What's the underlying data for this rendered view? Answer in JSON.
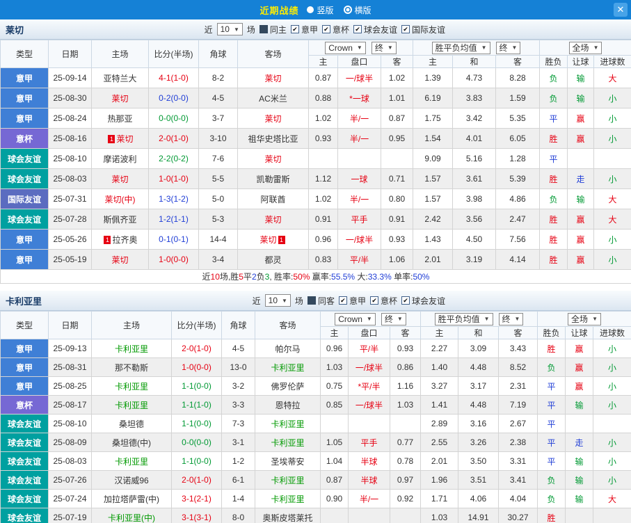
{
  "topbar": {
    "title": "近期战绩",
    "radio_vertical": "竖版",
    "radio_horizontal": "横版",
    "close": "✕"
  },
  "filter_words": {
    "near": "近",
    "games": "场"
  },
  "columns": {
    "cols": [
      "类型",
      "日期",
      "主场",
      "比分(半场)",
      "角球",
      "客场"
    ],
    "sub": [
      "主",
      "盘口",
      "客",
      "主",
      "和",
      "客",
      "胜负",
      "让球",
      "进球数"
    ],
    "bookmaker": "Crown",
    "final1": "终",
    "avg": "胜平负均值",
    "final2": "终",
    "scope": "全场"
  },
  "tables": [
    {
      "team": "莱切",
      "focal": "red",
      "filter": {
        "count": "10",
        "checks": [
          {
            "label": "同主",
            "checked": false,
            "solid": true
          },
          {
            "label": "意甲",
            "checked": true
          },
          {
            "label": "意杯",
            "checked": true
          },
          {
            "label": "球会友谊",
            "checked": true
          },
          {
            "label": "国际友谊",
            "checked": true
          }
        ]
      },
      "rows": [
        {
          "type": "意甲",
          "tc": "serie",
          "date": "25-09-14",
          "home": "亚特兰大",
          "hf": false,
          "hb": "",
          "score": "4-1(1-0)",
          "sc": "red",
          "corner": "8-2",
          "away": "莱切",
          "af": true,
          "ab": "",
          "o1": "0.87",
          "hcp": "一/球半",
          "o2": "1.02",
          "a1": "1.39",
          "a2": "4.73",
          "a3": "8.28",
          "r": "负",
          "rc": "green",
          "hr": "输",
          "hrc": "green",
          "g": "大",
          "gc": "red"
        },
        {
          "type": "意甲",
          "tc": "serie",
          "date": "25-08-30",
          "home": "莱切",
          "hf": true,
          "hb": "",
          "score": "0-2(0-0)",
          "sc": "blue",
          "corner": "4-5",
          "away": "AC米兰",
          "af": false,
          "ab": "",
          "o1": "0.88",
          "hcp": "*一球",
          "o2": "1.01",
          "a1": "6.19",
          "a2": "3.83",
          "a3": "1.59",
          "r": "负",
          "rc": "green",
          "hr": "输",
          "hrc": "green",
          "g": "小",
          "gc": "green"
        },
        {
          "type": "意甲",
          "tc": "serie",
          "date": "25-08-24",
          "home": "热那亚",
          "hf": false,
          "hb": "",
          "score": "0-0(0-0)",
          "sc": "green",
          "corner": "3-7",
          "away": "莱切",
          "af": true,
          "ab": "",
          "o1": "1.02",
          "hcp": "半/一",
          "o2": "0.87",
          "a1": "1.75",
          "a2": "3.42",
          "a3": "5.35",
          "r": "平",
          "rc": "blue",
          "hr": "赢",
          "hrc": "red",
          "g": "小",
          "gc": "green"
        },
        {
          "type": "意杯",
          "tc": "cup",
          "date": "25-08-16",
          "home": "莱切",
          "hf": true,
          "hb": "1",
          "score": "2-0(1-0)",
          "sc": "red",
          "corner": "3-10",
          "away": "祖华史塔比亚",
          "af": false,
          "ab": "",
          "o1": "0.93",
          "hcp": "半/一",
          "o2": "0.95",
          "a1": "1.54",
          "a2": "4.01",
          "a3": "6.05",
          "r": "胜",
          "rc": "red",
          "hr": "赢",
          "hrc": "red",
          "g": "小",
          "gc": "green"
        },
        {
          "type": "球会友谊",
          "tc": "club",
          "date": "25-08-10",
          "home": "摩诺波利",
          "hf": false,
          "hb": "",
          "score": "2-2(0-2)",
          "sc": "green",
          "corner": "7-6",
          "away": "莱切",
          "af": true,
          "ab": "",
          "o1": "",
          "hcp": "",
          "o2": "",
          "a1": "9.09",
          "a2": "5.16",
          "a3": "1.28",
          "r": "平",
          "rc": "blue",
          "hr": "",
          "hrc": "dark",
          "g": "",
          "gc": "dark"
        },
        {
          "type": "球会友谊",
          "tc": "club",
          "date": "25-08-03",
          "home": "莱切",
          "hf": true,
          "hb": "",
          "score": "1-0(1-0)",
          "sc": "red",
          "corner": "5-5",
          "away": "凯勒雷斯",
          "af": false,
          "ab": "",
          "o1": "1.12",
          "hcp": "一球",
          "o2": "0.71",
          "a1": "1.57",
          "a2": "3.61",
          "a3": "5.39",
          "r": "胜",
          "rc": "red",
          "hr": "走",
          "hrc": "blue",
          "g": "小",
          "gc": "green"
        },
        {
          "type": "国际友谊",
          "tc": "intl",
          "date": "25-07-31",
          "home": "莱切(中)",
          "hf": true,
          "hb": "",
          "score": "1-3(1-2)",
          "sc": "blue",
          "corner": "5-0",
          "away": "阿联酋",
          "af": false,
          "ab": "",
          "o1": "1.02",
          "hcp": "半/一",
          "o2": "0.80",
          "a1": "1.57",
          "a2": "3.98",
          "a3": "4.86",
          "r": "负",
          "rc": "green",
          "hr": "输",
          "hrc": "green",
          "g": "大",
          "gc": "red"
        },
        {
          "type": "球会友谊",
          "tc": "club",
          "date": "25-07-28",
          "home": "斯佩齐亚",
          "hf": false,
          "hb": "",
          "score": "1-2(1-1)",
          "sc": "blue",
          "corner": "5-3",
          "away": "莱切",
          "af": true,
          "ab": "",
          "o1": "0.91",
          "hcp": "平手",
          "o2": "0.91",
          "a1": "2.42",
          "a2": "3.56",
          "a3": "2.47",
          "r": "胜",
          "rc": "red",
          "hr": "赢",
          "hrc": "red",
          "g": "大",
          "gc": "red"
        },
        {
          "type": "意甲",
          "tc": "serie",
          "date": "25-05-26",
          "home": "拉齐奥",
          "hf": false,
          "hb": "1",
          "score": "0-1(0-1)",
          "sc": "blue",
          "corner": "14-4",
          "away": "莱切",
          "af": true,
          "ab": "1",
          "o1": "0.96",
          "hcp": "一/球半",
          "o2": "0.93",
          "a1": "1.43",
          "a2": "4.50",
          "a3": "7.56",
          "r": "胜",
          "rc": "red",
          "hr": "赢",
          "hrc": "red",
          "g": "小",
          "gc": "green"
        },
        {
          "type": "意甲",
          "tc": "serie",
          "date": "25-05-19",
          "home": "莱切",
          "hf": true,
          "hb": "",
          "score": "1-0(0-0)",
          "sc": "red",
          "corner": "3-4",
          "away": "都灵",
          "af": false,
          "ab": "",
          "o1": "0.83",
          "hcp": "平/半",
          "o2": "1.06",
          "a1": "2.01",
          "a2": "3.19",
          "a3": "4.14",
          "r": "胜",
          "rc": "red",
          "hr": "赢",
          "hrc": "red",
          "g": "小",
          "gc": "green"
        }
      ],
      "summary": [
        {
          "t": "近",
          "c": "dark"
        },
        {
          "t": "10",
          "c": "red"
        },
        {
          "t": "场,胜",
          "c": "dark"
        },
        {
          "t": "5",
          "c": "red"
        },
        {
          "t": "平",
          "c": "dark"
        },
        {
          "t": "2",
          "c": "blue"
        },
        {
          "t": "负",
          "c": "dark"
        },
        {
          "t": "3",
          "c": "green"
        },
        {
          "t": ", 胜率:",
          "c": "dark"
        },
        {
          "t": "50%",
          "c": "red"
        },
        {
          "t": " 赢率:",
          "c": "dark"
        },
        {
          "t": "55.5%",
          "c": "blue"
        },
        {
          "t": " 大:",
          "c": "dark"
        },
        {
          "t": "33.3%",
          "c": "blue"
        },
        {
          "t": " 单率:",
          "c": "dark"
        },
        {
          "t": "50%",
          "c": "blue"
        }
      ]
    },
    {
      "team": "卡利亚里",
      "focal": "green",
      "filter": {
        "count": "10",
        "checks": [
          {
            "label": "同客",
            "checked": false,
            "solid": true
          },
          {
            "label": "意甲",
            "checked": true
          },
          {
            "label": "意杯",
            "checked": true
          },
          {
            "label": "球会友谊",
            "checked": true
          }
        ]
      },
      "rows": [
        {
          "type": "意甲",
          "tc": "serie",
          "date": "25-09-13",
          "home": "卡利亚里",
          "hf": true,
          "hb": "",
          "score": "2-0(1-0)",
          "sc": "red",
          "corner": "4-5",
          "away": "帕尔马",
          "af": false,
          "ab": "",
          "o1": "0.96",
          "hcp": "平/半",
          "o2": "0.93",
          "a1": "2.27",
          "a2": "3.09",
          "a3": "3.43",
          "r": "胜",
          "rc": "red",
          "hr": "赢",
          "hrc": "red",
          "g": "小",
          "gc": "green"
        },
        {
          "type": "意甲",
          "tc": "serie",
          "date": "25-08-31",
          "home": "那不勒斯",
          "hf": false,
          "hb": "",
          "score": "1-0(0-0)",
          "sc": "red",
          "corner": "13-0",
          "away": "卡利亚里",
          "af": true,
          "ab": "",
          "o1": "1.03",
          "hcp": "一/球半",
          "o2": "0.86",
          "a1": "1.40",
          "a2": "4.48",
          "a3": "8.52",
          "r": "负",
          "rc": "green",
          "hr": "赢",
          "hrc": "red",
          "g": "小",
          "gc": "green"
        },
        {
          "type": "意甲",
          "tc": "serie",
          "date": "25-08-25",
          "home": "卡利亚里",
          "hf": true,
          "hb": "",
          "score": "1-1(0-0)",
          "sc": "green",
          "corner": "3-2",
          "away": "佛罗伦萨",
          "af": false,
          "ab": "",
          "o1": "0.75",
          "hcp": "*平/半",
          "o2": "1.16",
          "a1": "3.27",
          "a2": "3.17",
          "a3": "2.31",
          "r": "平",
          "rc": "blue",
          "hr": "赢",
          "hrc": "red",
          "g": "小",
          "gc": "green"
        },
        {
          "type": "意杯",
          "tc": "cup",
          "date": "25-08-17",
          "home": "卡利亚里",
          "hf": true,
          "hb": "",
          "score": "1-1(1-0)",
          "sc": "green",
          "corner": "3-3",
          "away": "恩特拉",
          "af": false,
          "ab": "",
          "o1": "0.85",
          "hcp": "一/球半",
          "o2": "1.03",
          "a1": "1.41",
          "a2": "4.48",
          "a3": "7.19",
          "r": "平",
          "rc": "blue",
          "hr": "输",
          "hrc": "green",
          "g": "小",
          "gc": "green"
        },
        {
          "type": "球会友谊",
          "tc": "club",
          "date": "25-08-10",
          "home": "桑坦德",
          "hf": false,
          "hb": "",
          "score": "1-1(0-0)",
          "sc": "green",
          "corner": "7-3",
          "away": "卡利亚里",
          "af": true,
          "ab": "",
          "o1": "",
          "hcp": "",
          "o2": "",
          "a1": "2.89",
          "a2": "3.16",
          "a3": "2.67",
          "r": "平",
          "rc": "blue",
          "hr": "",
          "hrc": "dark",
          "g": "",
          "gc": "dark"
        },
        {
          "type": "球会友谊",
          "tc": "club",
          "date": "25-08-09",
          "home": "桑坦德(中)",
          "hf": false,
          "hb": "",
          "score": "0-0(0-0)",
          "sc": "green",
          "corner": "3-1",
          "away": "卡利亚里",
          "af": true,
          "ab": "",
          "o1": "1.05",
          "hcp": "平手",
          "o2": "0.77",
          "a1": "2.55",
          "a2": "3.26",
          "a3": "2.38",
          "r": "平",
          "rc": "blue",
          "hr": "走",
          "hrc": "blue",
          "g": "小",
          "gc": "green"
        },
        {
          "type": "球会友谊",
          "tc": "club",
          "date": "25-08-03",
          "home": "卡利亚里",
          "hf": true,
          "hb": "",
          "score": "1-1(0-0)",
          "sc": "green",
          "corner": "1-2",
          "away": "圣埃蒂安",
          "af": false,
          "ab": "",
          "o1": "1.04",
          "hcp": "半球",
          "o2": "0.78",
          "a1": "2.01",
          "a2": "3.50",
          "a3": "3.31",
          "r": "平",
          "rc": "blue",
          "hr": "输",
          "hrc": "green",
          "g": "小",
          "gc": "green"
        },
        {
          "type": "球会友谊",
          "tc": "club",
          "date": "25-07-26",
          "home": "汉诺威96",
          "hf": false,
          "hb": "",
          "score": "2-0(1-0)",
          "sc": "red",
          "corner": "6-1",
          "away": "卡利亚里",
          "af": true,
          "ab": "",
          "o1": "0.87",
          "hcp": "半球",
          "o2": "0.97",
          "a1": "1.96",
          "a2": "3.51",
          "a3": "3.41",
          "r": "负",
          "rc": "green",
          "hr": "输",
          "hrc": "green",
          "g": "小",
          "gc": "green"
        },
        {
          "type": "球会友谊",
          "tc": "club",
          "date": "25-07-24",
          "home": "加拉塔萨雷(中)",
          "hf": false,
          "hb": "",
          "score": "3-1(2-1)",
          "sc": "red",
          "corner": "1-4",
          "away": "卡利亚里",
          "af": true,
          "ab": "",
          "o1": "0.90",
          "hcp": "半/一",
          "o2": "0.92",
          "a1": "1.71",
          "a2": "4.06",
          "a3": "4.04",
          "r": "负",
          "rc": "green",
          "hr": "输",
          "hrc": "green",
          "g": "大",
          "gc": "red"
        },
        {
          "type": "球会友谊",
          "tc": "club",
          "date": "25-07-19",
          "home": "卡利亚里(中)",
          "hf": true,
          "hb": "",
          "score": "3-1(3-1)",
          "sc": "red",
          "corner": "8-0",
          "away": "奥斯皮塔莱托",
          "af": false,
          "ab": "",
          "o1": "",
          "hcp": "",
          "o2": "",
          "a1": "1.03",
          "a2": "14.91",
          "a3": "30.27",
          "r": "胜",
          "rc": "red",
          "hr": "",
          "hrc": "dark",
          "g": "",
          "gc": "dark"
        }
      ],
      "summary": null
    }
  ]
}
